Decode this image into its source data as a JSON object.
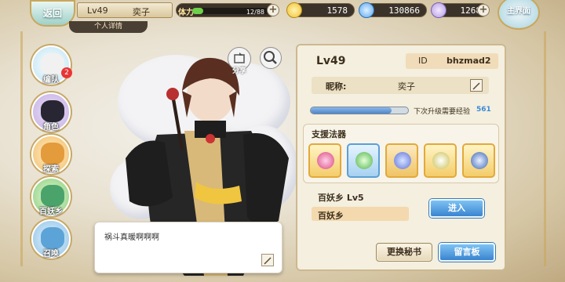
{
  "topbar": {
    "back_label": "返回",
    "home_label": "主界面",
    "level": "Lv49",
    "player_name": "奕子",
    "personal_details_tab": "个人详情",
    "stamina_label": "体力",
    "stamina": "12/88",
    "stamina_fraction": 0.136,
    "gold": "1578",
    "gems": "130866",
    "tickets": "1268",
    "colors": {
      "gold": "#f2c12e",
      "gem": "#5aa8f0",
      "ticket": "#b59be0"
    }
  },
  "nav": [
    {
      "label": "编队",
      "icon": "team-icon",
      "badge": "2"
    },
    {
      "label": "角色",
      "icon": "character-icon"
    },
    {
      "label": "探索",
      "icon": "explore-icon"
    },
    {
      "label": "百妖乡",
      "icon": "village-icon"
    },
    {
      "label": "召唤",
      "icon": "summon-icon"
    }
  ],
  "tools": {
    "share_label": "分享"
  },
  "dialogue": {
    "text": "祸斗真暖啊啊啊"
  },
  "profile": {
    "level": "Lv49",
    "id_label": "ID",
    "id_value": "bhzmad2",
    "nickname_label": "昵称:",
    "nickname_value": "奕子",
    "exp_fraction": 0.83,
    "exp_label": "下次升级需要经验",
    "exp_value": "561",
    "support_title": "支援法器",
    "support_items": [
      "pink-gem-artifact-icon",
      "green-vine-artifact-icon",
      "blue-whirl-artifact-icon",
      "golden-orb-artifact-icon",
      "blue-sword-artifact-icon"
    ],
    "village_line": "百妖乡  Lv5",
    "village_name": "百妖乡",
    "enter_label": "进入",
    "change_secretary_label": "更换秘书",
    "message_board_label": "留言板"
  }
}
